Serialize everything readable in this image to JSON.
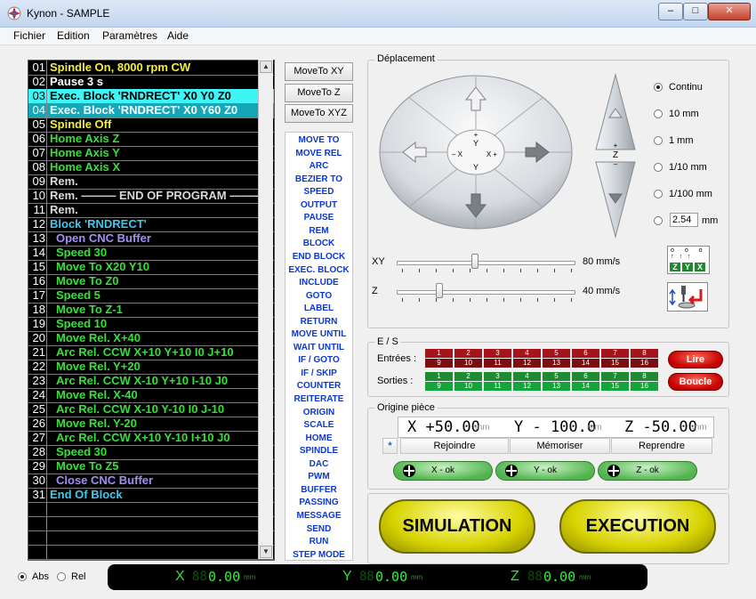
{
  "window": {
    "title": "Kynon  -  SAMPLE",
    "minimize": "–",
    "maximize": "□",
    "close": "✕"
  },
  "menu": [
    "Fichier",
    "Edition",
    "Paramètres",
    "Aide"
  ],
  "program": [
    {
      "n": "01",
      "text": "Spindle On, 8000 rpm CW",
      "color": "#f5ef3a"
    },
    {
      "n": "02",
      "text": "Pause 3 s",
      "color": "#ffffff"
    },
    {
      "n": "03",
      "text": "Exec. Block 'RNDRECT' X0 Y0 Z0",
      "color": "#ffffff",
      "selected": true
    },
    {
      "n": "04",
      "text": "Exec. Block 'RNDRECT' X0 Y60 Z0",
      "color": "#ffffff",
      "bg": "#13a7b8"
    },
    {
      "n": "05",
      "text": "Spindle Off",
      "color": "#f5ef3a"
    },
    {
      "n": "06",
      "text": "Home Axis Z",
      "color": "#35e135"
    },
    {
      "n": "07",
      "text": "Home Axis Y",
      "color": "#35e135"
    },
    {
      "n": "08",
      "text": "Home Axis X",
      "color": "#35e135"
    },
    {
      "n": "09",
      "text": "Rem.",
      "color": "#d9d9d9"
    },
    {
      "n": "10",
      "text": "Rem.  ——— END OF PROGRAM ———",
      "color": "#d9d9d9"
    },
    {
      "n": "11",
      "text": "Rem.",
      "color": "#d9d9d9"
    },
    {
      "n": "12",
      "text": "Block 'RNDRECT'",
      "color": "#40c8f0"
    },
    {
      "n": "13",
      "text": "Open CNC Buffer",
      "color": "#a68cf7",
      "indent": true
    },
    {
      "n": "14",
      "text": "Speed 30",
      "color": "#35e135",
      "indent": true
    },
    {
      "n": "15",
      "text": "Move To X20 Y10",
      "color": "#35e135",
      "indent": true
    },
    {
      "n": "16",
      "text": "Move To Z0",
      "color": "#35e135",
      "indent": true
    },
    {
      "n": "17",
      "text": "Speed 5",
      "color": "#35e135",
      "indent": true
    },
    {
      "n": "18",
      "text": "Move To Z-1",
      "color": "#35e135",
      "indent": true
    },
    {
      "n": "19",
      "text": "Speed 10",
      "color": "#35e135",
      "indent": true
    },
    {
      "n": "20",
      "text": "Move Rel. X+40",
      "color": "#35e135",
      "indent": true
    },
    {
      "n": "21",
      "text": "Arc Rel. CCW X+10 Y+10 I0 J+10",
      "color": "#35e135",
      "indent": true
    },
    {
      "n": "22",
      "text": "Move Rel. Y+20",
      "color": "#35e135",
      "indent": true
    },
    {
      "n": "23",
      "text": "Arc Rel. CCW X-10 Y+10 I-10 J0",
      "color": "#35e135",
      "indent": true
    },
    {
      "n": "24",
      "text": "Move Rel. X-40",
      "color": "#35e135",
      "indent": true
    },
    {
      "n": "25",
      "text": "Arc Rel. CCW X-10 Y-10 I0 J-10",
      "color": "#35e135",
      "indent": true
    },
    {
      "n": "26",
      "text": "Move Rel. Y-20",
      "color": "#35e135",
      "indent": true
    },
    {
      "n": "27",
      "text": "Arc Rel. CCW X+10 Y-10 I+10 J0",
      "color": "#35e135",
      "indent": true
    },
    {
      "n": "28",
      "text": "Speed 30",
      "color": "#35e135",
      "indent": true
    },
    {
      "n": "29",
      "text": "Move To Z5",
      "color": "#35e135",
      "indent": true
    },
    {
      "n": "30",
      "text": "Close CNC Buffer",
      "color": "#a68cf7",
      "indent": true
    },
    {
      "n": "31",
      "text": "End Of Block",
      "color": "#40c8f0"
    }
  ],
  "move_buttons": [
    "MoveTo XY",
    "MoveTo Z",
    "MoveTo XYZ"
  ],
  "commands": [
    "MOVE TO",
    "MOVE REL",
    "ARC",
    "BEZIER TO",
    "SPEED",
    "OUTPUT",
    "PAUSE",
    "REM",
    "BLOCK",
    "END BLOCK",
    "EXEC. BLOCK",
    "INCLUDE",
    "GOTO",
    "LABEL",
    "RETURN",
    "MOVE UNTIL",
    "WAIT UNTIL",
    "IF / GOTO",
    "IF / SKIP",
    "COUNTER",
    "REITERATE",
    "ORIGIN",
    "SCALE",
    "HOME",
    "SPINDLE",
    "DAC",
    "PWM",
    "BUFFER",
    "PASSING",
    "MESSAGE",
    "SEND",
    "RUN",
    "STEP MODE"
  ],
  "deplacement": {
    "title": "Déplacement",
    "center": {
      "yplus": "+",
      "ylabel": "Y",
      "xminus": "– X",
      "xplus": "X +",
      "ybottom": "Y"
    },
    "z": {
      "plus": "+",
      "label": "Z",
      "minus": "–"
    },
    "steps": [
      {
        "label": "Continu",
        "checked": true
      },
      {
        "label": "10 mm",
        "checked": false
      },
      {
        "label": "1 mm",
        "checked": false
      },
      {
        "label": "1/10 mm",
        "checked": false
      },
      {
        "label": "1/100 mm",
        "checked": false
      }
    ],
    "custom_value": "2.54",
    "custom_unit": "mm",
    "sliders": [
      {
        "label": "XY",
        "value": "80 mm/s",
        "fraction": 0.42
      },
      {
        "label": "Z",
        "value": "40 mm/s",
        "fraction": 0.22
      }
    ],
    "zyx_icon": [
      "Z",
      "Y",
      "X"
    ]
  },
  "es": {
    "title": "E / S",
    "inputs_label": "Entrées :",
    "outputs_label": "Sorties :",
    "top": [
      "1",
      "2",
      "3",
      "4",
      "5",
      "6",
      "7",
      "8"
    ],
    "bottom": [
      "9",
      "10",
      "11",
      "12",
      "13",
      "14",
      "15",
      "16"
    ],
    "lire": "Lire",
    "boucle": "Boucle"
  },
  "origine": {
    "title": "Origine pièce",
    "x": "X +50.00",
    "y": "Y - 100.0",
    "z": "Z -50.00",
    "unit": "mm",
    "star": "*",
    "buttons": [
      "Rejoindre",
      "Mémoriser",
      "Reprendre"
    ],
    "ok": [
      "X - ok",
      "Y - ok",
      "Z - ok"
    ]
  },
  "simulation": "SIMULATION",
  "execution": "EXECUTION",
  "mode": {
    "abs": "Abs",
    "rel": "Rel",
    "abs_checked": true
  },
  "dro": [
    {
      "axis": "X",
      "dim": "88",
      "value": "0.00",
      "unit": "mm"
    },
    {
      "axis": "Y",
      "dim": "88",
      "value": "0.00",
      "unit": "mm"
    },
    {
      "axis": "Z",
      "dim": "88",
      "value": "0.00",
      "unit": "mm"
    }
  ],
  "colors": {
    "accent": "#0b38d4",
    "selected": "#3ef5f5",
    "green": "#2ff23a"
  }
}
